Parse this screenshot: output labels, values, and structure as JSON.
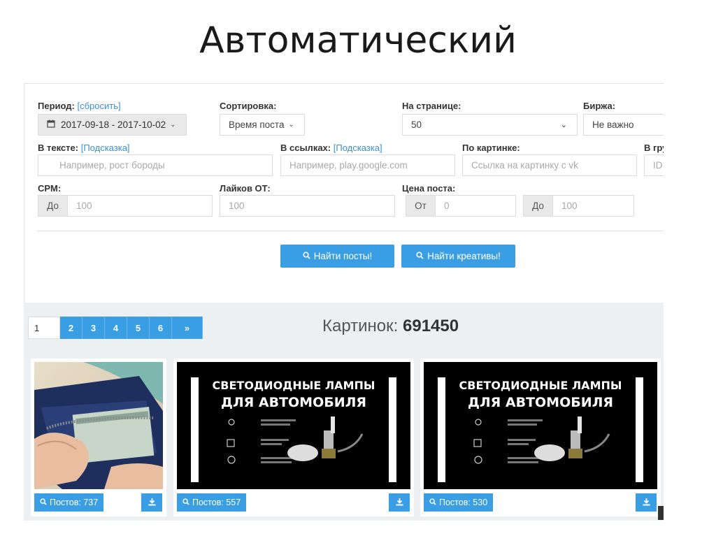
{
  "slide_title": "Автоматический",
  "filters": {
    "period_label": "Период:",
    "period_reset": "[сбросить]",
    "period_value": "2017-09-18 - 2017-10-02",
    "sort_label": "Сортировка:",
    "sort_value": "Время поста",
    "per_page_label": "На странице:",
    "per_page_value": "50",
    "exchange_label": "Биржа:",
    "exchange_value": "Не важно",
    "text_label": "В тексте:",
    "text_hint": "[Подсказка]",
    "text_placeholder": "Например, рост бороды",
    "links_label": "В ссылках:",
    "links_hint": "[Подсказка]",
    "links_placeholder": "Например, play.google.com",
    "image_label": "По картинке:",
    "image_placeholder": "Ссылка на картинку с vk",
    "group_label": "В гру",
    "group_placeholder": "ID",
    "cpm_label": "CPM:",
    "cpm_prefix": "До",
    "cpm_placeholder": "100",
    "likes_label": "Лайков ОТ:",
    "likes_placeholder": "100",
    "price_label": "Цена поста:",
    "price_from_prefix": "От",
    "price_from_placeholder": "0",
    "price_to_prefix": "До",
    "price_to_placeholder": "100"
  },
  "actions": {
    "find_posts": "Найти посты!",
    "find_creatives": "Найти креативы!"
  },
  "pagination": {
    "current": "1",
    "pages": [
      "2",
      "3",
      "4",
      "5",
      "6"
    ],
    "next": "»"
  },
  "results": {
    "count_label": "Картинок:",
    "count_value": "691450",
    "cards": [
      {
        "posts": "Постов: 737"
      },
      {
        "posts": "Постов: 557",
        "ad_line1": "СВЕТОДИОДНЫЕ ЛАМПЫ",
        "ad_line2": "ДЛЯ АВТОМОБИЛЯ"
      },
      {
        "posts": "Постов: 530",
        "ad_line1": "СВЕТОДИОДНЫЕ ЛАМПЫ",
        "ad_line2": "ДЛЯ АВТОМОБИЛЯ"
      }
    ]
  },
  "colors": {
    "accent": "#3a9ee4",
    "link": "#3b8fd4",
    "results_bg": "#ecf0f3"
  },
  "icons": [
    "calendar-icon",
    "chevron-down-icon",
    "search-icon",
    "download-icon"
  ]
}
